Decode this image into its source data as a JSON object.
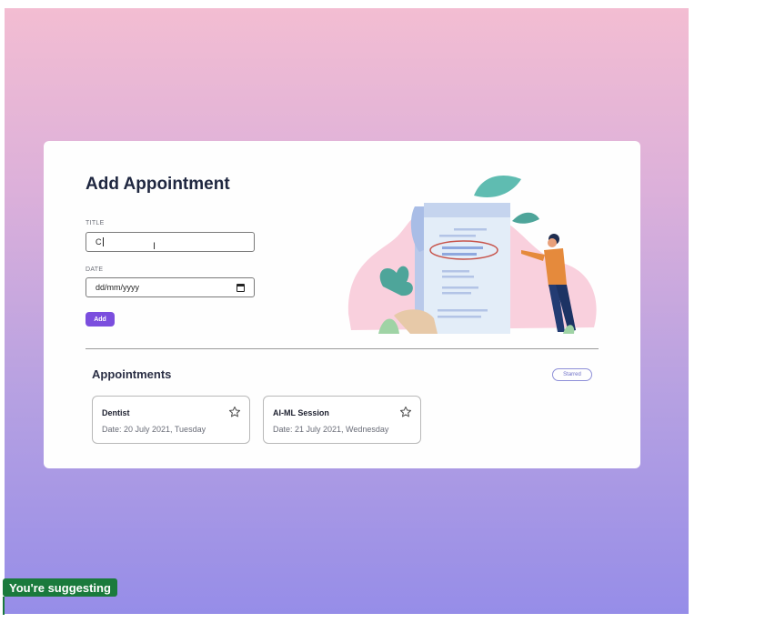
{
  "form": {
    "title": "Add Appointment",
    "title_label": "TITLE",
    "title_value": "C",
    "date_label": "DATE",
    "date_placeholder": "dd/mm/yyyy",
    "add_label": "Add"
  },
  "appointments": {
    "heading": "Appointments",
    "starred_label": "Starred",
    "items": [
      {
        "title": "Dentist",
        "date": "Date: 20 July 2021, Tuesday"
      },
      {
        "title": "AI-ML Session",
        "date": "Date: 21 July 2021, Wednesday"
      }
    ]
  },
  "overlay": {
    "suggesting_label": "You're suggesting"
  },
  "icons": {
    "star": "star-outline-icon",
    "calendar": "calendar-icon"
  },
  "colors": {
    "accent": "#7b4ede",
    "suggest": "#1a7a3c"
  }
}
